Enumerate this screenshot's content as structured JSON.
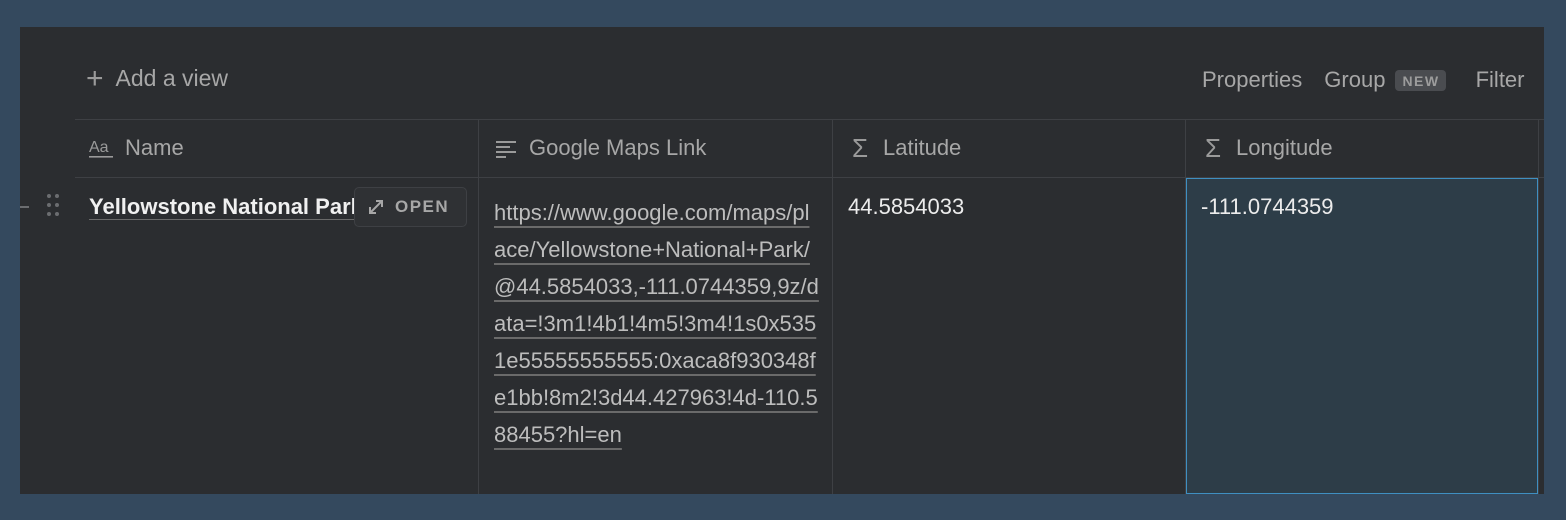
{
  "toolbar": {
    "add_view_icon": "plus-icon",
    "add_view_label": "Add a view",
    "properties_label": "Properties",
    "group_label": "Group",
    "group_badge": "NEW",
    "filter_label": "Filter"
  },
  "table": {
    "columns": [
      {
        "icon": "text-type-icon",
        "label": "Name"
      },
      {
        "icon": "text-lines-icon",
        "label": "Google Maps Link"
      },
      {
        "icon": "formula-sigma-icon",
        "label": "Latitude"
      },
      {
        "icon": "formula-sigma-icon",
        "label": "Longitude"
      }
    ],
    "rows": [
      {
        "name": "Yellowstone National Park",
        "open_label": "OPEN",
        "link": "https://www.google.com/maps/place/Yellowstone+National+Park/@44.5854033,-111.0744359,9z/data=!3m1!4b1!4m5!3m4!1s0x5351e55555555555:0xaca8f930348fe1bb!8m2!3d44.427963!4d-110.588455?hl=en",
        "latitude": "44.5854033",
        "longitude": "-111.0744359"
      }
    ]
  },
  "colors": {
    "page_bg": "#34495e",
    "panel_bg": "#2b2d30",
    "selected_cell_bg": "#2d3d48",
    "selected_cell_border": "#3f8fc1"
  }
}
